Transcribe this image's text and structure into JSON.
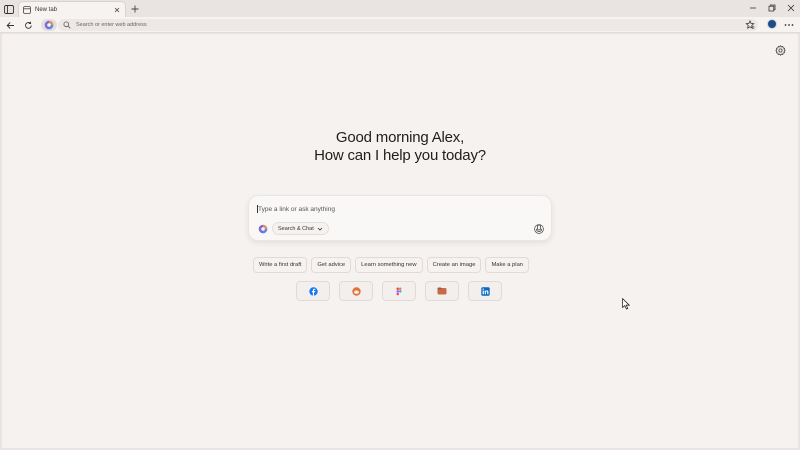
{
  "tabstrip": {
    "tab_title": "New tab"
  },
  "toolbar": {
    "address_placeholder": "Search or enter web address"
  },
  "main": {
    "greeting_line1": "Good morning Alex,",
    "greeting_line2": "How can I help you today?",
    "chat_placeholder": "Type a link or ask anything",
    "mode_label": "Search & Chat",
    "suggestions": [
      "Write a first draft",
      "Get advice",
      "Learn something new",
      "Create an image",
      "Make a plan"
    ],
    "shortcuts": [
      {
        "icon": "facebook-icon",
        "color": "#1877f2"
      },
      {
        "icon": "reddit-icon",
        "color": "#e0733a"
      },
      {
        "icon": "figma-icon",
        "color": "#e24a7a"
      },
      {
        "icon": "folder-icon",
        "color": "#c56a4a"
      },
      {
        "icon": "linkedin-icon",
        "color": "#0a66c2"
      }
    ]
  },
  "colors": {
    "background": "#e9e4e1",
    "content_background": "#f6f2f0",
    "avatar": "#1f4c84"
  }
}
